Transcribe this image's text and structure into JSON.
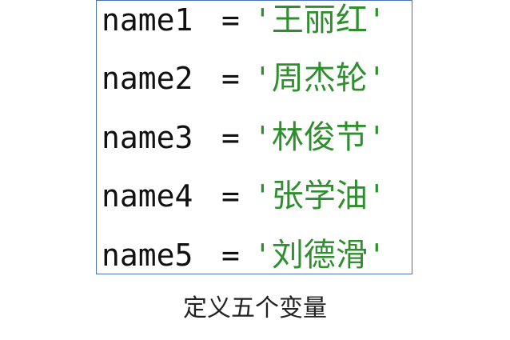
{
  "lines": [
    {
      "var": "name1",
      "op": "=",
      "open_quote": "'",
      "value": "王丽红",
      "close_quote": "'"
    },
    {
      "var": "name2",
      "op": "=",
      "open_quote": "'",
      "value": "周杰轮",
      "close_quote": "'"
    },
    {
      "var": "name3",
      "op": "=",
      "open_quote": "'",
      "value": "林俊节",
      "close_quote": "'"
    },
    {
      "var": "name4",
      "op": "=",
      "open_quote": "'",
      "value": "张学油",
      "close_quote": "'"
    },
    {
      "var": "name5",
      "op": "=",
      "open_quote": "'",
      "value": "刘德滑",
      "close_quote": "'"
    }
  ],
  "caption": "定义五个变量",
  "colors": {
    "frame_border": "#4a74b4",
    "code_text": "#111111",
    "string_text": "#2f8f2f",
    "caption_text": "#222222"
  }
}
